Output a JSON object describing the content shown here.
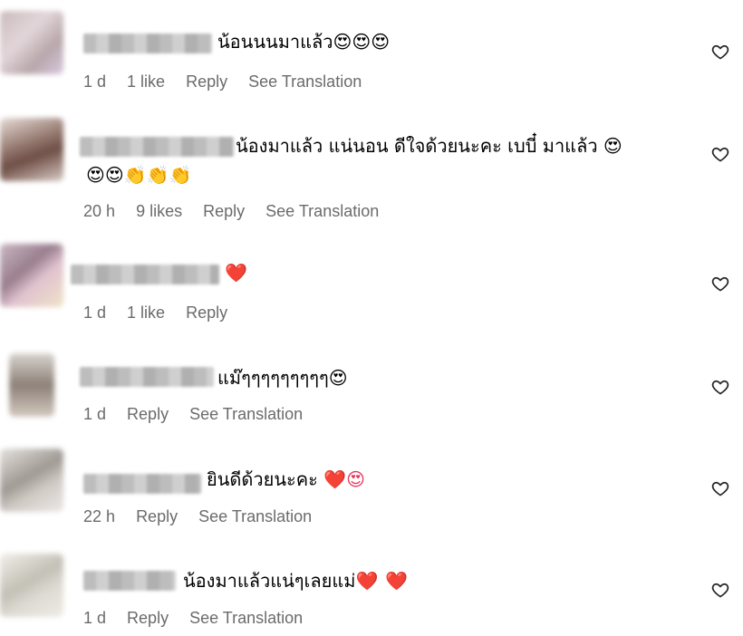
{
  "comments": [
    {
      "text": "น้อนนนมาแล้ว",
      "emoji": "😍😍😍",
      "time": "1 d",
      "likes": "1 like",
      "reply": "Reply",
      "translate": "See Translation"
    },
    {
      "text": "น้องมาแล้ว แน่นอน ดีใจด้วยนะคะ เบบี๋ มาแล้ว",
      "emoji": "😍",
      "text2": "",
      "emoji2": "😍😍👏👏👏",
      "time": "20 h",
      "likes": "9 likes",
      "reply": "Reply",
      "translate": "See Translation"
    },
    {
      "text": "",
      "emoji": "❤️",
      "time": "1 d",
      "likes": "1 like",
      "reply": "Reply"
    },
    {
      "text": "แม๊ๆๆๆๆๆๆๆๆๆ",
      "emoji": "😍",
      "time": "1 d",
      "reply": "Reply",
      "translate": "See Translation"
    },
    {
      "text": "ยินดีด้วยนะคะ",
      "emoji": "❤️😍",
      "time": "22 h",
      "reply": "Reply",
      "translate": "See Translation"
    },
    {
      "text": "น้องมาแล้วแน่ๆเลยแม่",
      "emoji": "❤️❤️",
      "time": "1 d",
      "reply": "Reply",
      "translate": "See Translation"
    }
  ],
  "colors": {
    "meta_gray": "#6b6b6b",
    "heart_icon": "heart-outline-icon"
  }
}
